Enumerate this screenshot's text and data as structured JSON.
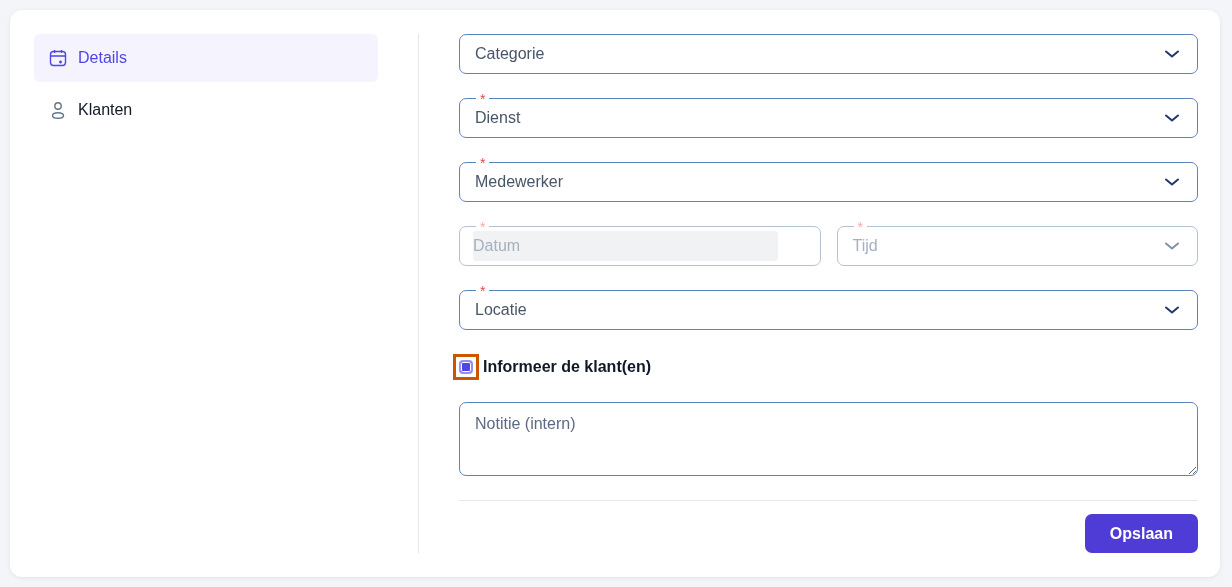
{
  "sidebar": {
    "items": [
      {
        "label": "Details",
        "selected": true
      },
      {
        "label": "Klanten",
        "selected": false
      }
    ]
  },
  "form": {
    "rows": [
      [
        {
          "kind": "select",
          "placeholder": "Categorie",
          "disabled": false
        }
      ],
      [
        {
          "kind": "select",
          "placeholder": "Dienst",
          "required_mark": "*",
          "disabled": false
        }
      ],
      [
        {
          "kind": "select",
          "placeholder": "Medewerker",
          "required_mark": "*",
          "disabled": false
        }
      ],
      [
        {
          "kind": "date",
          "placeholder": "Datum",
          "required_mark": "*",
          "disabled": true
        },
        {
          "kind": "select",
          "placeholder": "Tijd",
          "required_mark": "*",
          "disabled": true
        }
      ],
      [
        {
          "kind": "select",
          "placeholder": "Locatie",
          "required_mark": "*",
          "disabled": false
        }
      ]
    ],
    "notify": {
      "label": "Informeer de klant(en)",
      "checked": true,
      "focused": true
    },
    "note": {
      "placeholder": "Notitie (intern)"
    },
    "save_button": "Opslaan"
  }
}
